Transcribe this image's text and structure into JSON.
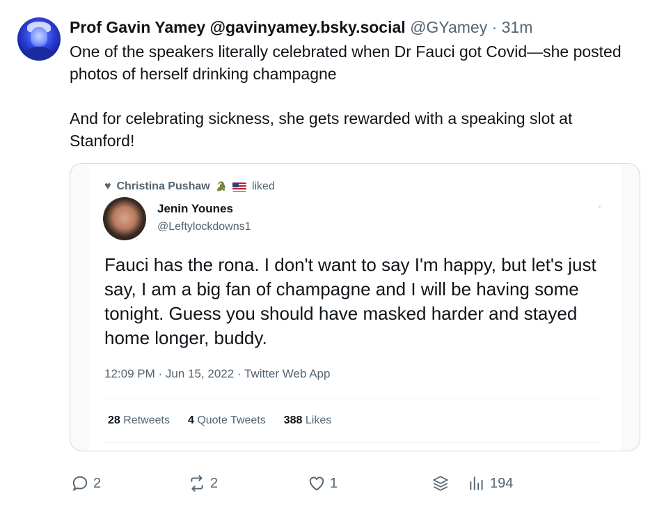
{
  "post": {
    "author_name": "Prof Gavin Yamey @gavinyamey.bsky.social",
    "author_handle": "@GYamey",
    "separator": " · ",
    "time": "31m",
    "text_p1": "One of the speakers literally celebrated when Dr Fauci got Covid—she posted photos of herself drinking champagne",
    "text_p2": "And for celebrating sickness, she gets rewarded with a speaking slot at Stanford!"
  },
  "quoted_screenshot": {
    "liked_by": "Christina Pushaw",
    "liked_label": "liked",
    "author_name": "Jenin Younes",
    "author_handle": "@Leftylockdowns1",
    "text": "Fauci has the rona.  I don't want to say I'm happy, but let's just say, I am a big fan of champagne and I will be having some tonight.  Guess you should have masked harder and stayed home longer, buddy.",
    "timestamp": "12:09 PM · Jun 15, 2022 · Twitter Web App",
    "retweets_count": "28",
    "retweets_label": "Retweets",
    "quotes_count": "4",
    "quotes_label": "Quote Tweets",
    "likes_count": "388",
    "likes_label": "Likes"
  },
  "actions": {
    "replies": "2",
    "reposts": "2",
    "likes": "1",
    "views": "194"
  },
  "icons": [
    "heart-icon",
    "crocodile-icon",
    "us-flag-icon",
    "reply-icon",
    "repost-icon",
    "like-icon",
    "feeds-icon",
    "views-icon"
  ],
  "colors": {
    "text_primary": "#0f1419",
    "text_secondary": "#536471",
    "border": "#cfd9de"
  }
}
